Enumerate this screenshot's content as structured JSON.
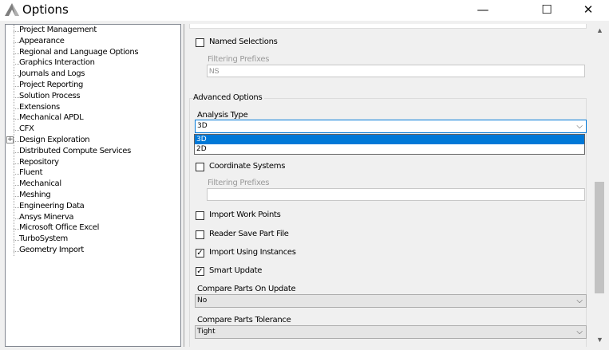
{
  "window": {
    "title": "Options",
    "minimize_glyph": "—",
    "maximize_glyph": "☐",
    "close_glyph": "✕"
  },
  "tree": {
    "items": [
      {
        "label": "Project Management"
      },
      {
        "label": "Appearance"
      },
      {
        "label": "Regional and Language Options"
      },
      {
        "label": "Graphics Interaction"
      },
      {
        "label": "Journals and Logs"
      },
      {
        "label": "Project Reporting"
      },
      {
        "label": "Solution Process"
      },
      {
        "label": "Extensions"
      },
      {
        "label": "Mechanical APDL"
      },
      {
        "label": "CFX"
      },
      {
        "label": "Design Exploration",
        "expander": "+"
      },
      {
        "label": "Distributed Compute Services"
      },
      {
        "label": "Repository"
      },
      {
        "label": "Fluent"
      },
      {
        "label": "Mechanical"
      },
      {
        "label": "Meshing"
      },
      {
        "label": "Engineering Data"
      },
      {
        "label": "Ansys Minerva"
      },
      {
        "label": "Microsoft Office Excel"
      },
      {
        "label": "TurboSystem"
      },
      {
        "label": "Geometry Import"
      }
    ]
  },
  "panel": {
    "named_selections": {
      "label": "Named Selections",
      "checked": false
    },
    "ns_filter_label": "Filtering Prefixes",
    "ns_filter_value": "NS",
    "advanced_group_label": "Advanced Options",
    "analysis_type_label": "Analysis Type",
    "analysis_type_value": "3D",
    "analysis_type_options": [
      "3D",
      "2D"
    ],
    "coordinate_systems": {
      "label": "Coordinate Systems",
      "checked": false
    },
    "cs_filter_label": "Filtering Prefixes",
    "cs_filter_value": "",
    "import_work_points": {
      "label": "Import Work Points",
      "checked": false
    },
    "reader_save_part_file": {
      "label": "Reader Save Part File",
      "checked": false
    },
    "import_using_instances": {
      "label": "Import Using Instances",
      "checked": true
    },
    "smart_update": {
      "label": "Smart Update",
      "checked": true
    },
    "compare_parts_label": "Compare Parts On Update",
    "compare_parts_value": "No",
    "compare_tolerance_label": "Compare Parts Tolerance",
    "compare_tolerance_value": "Tight",
    "check_glyph": "✓",
    "chevron_glyph": "⌵"
  },
  "scrollbar": {
    "up_glyph": "▲",
    "down_glyph": "▼"
  },
  "colors": {
    "accent": "#0078d7",
    "app_icon": "#7f7f7f"
  }
}
